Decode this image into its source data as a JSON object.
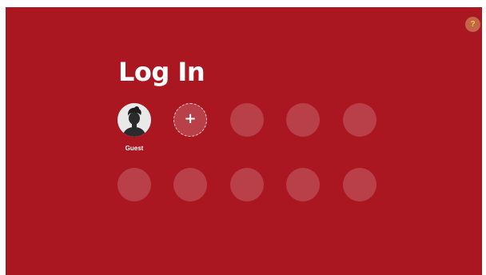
{
  "page": {
    "title": "Log In"
  },
  "help_button": {
    "label": "?",
    "icon": "help-icon"
  },
  "profiles": {
    "users": [
      {
        "label": "Guest",
        "icon": "guest-avatar-icon"
      }
    ],
    "add_button": {
      "label": "+",
      "icon": "plus-icon"
    },
    "empty_slots_count": 8
  },
  "colors": {
    "background": "#aa1721",
    "help_button": "#c2654b",
    "help_text": "#f2d21b",
    "text": "#ffffff"
  }
}
